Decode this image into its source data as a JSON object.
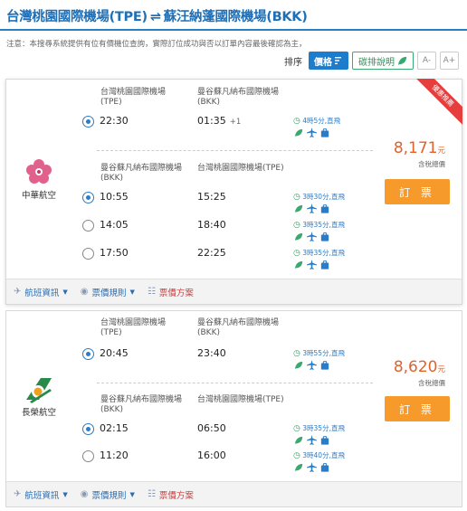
{
  "header": {
    "origin": "台灣桃園國際機場(TPE)",
    "arrow": "⇌",
    "destination": "蘇汪納蓬國際機場(BKK)"
  },
  "notice": "注意：本搜尋系統提供有位有價機位查詢，實際訂位成功與否以訂單內容最後確認為主，",
  "sort": {
    "label": "排序",
    "price_label": "價格",
    "eco_label": "碳排說明",
    "font_small": "A-",
    "font_large": "A+"
  },
  "results": [
    {
      "ribbon": "優惠推薦",
      "airline": "中華航空",
      "price": "8,171",
      "price_unit": "元",
      "tax_note": "含稅總價",
      "book_label": "訂 票",
      "outbound": {
        "dep_airport": "台灣桃園國際機場(TPE)",
        "arr_airport": "曼谷蘇凡納布國際機場(BKK)",
        "options": [
          {
            "dep": "22:30",
            "arr": "01:35",
            "day_offset": "+1",
            "duration": "4時5分,直飛",
            "selected": true
          }
        ]
      },
      "return": {
        "dep_airport": "曼谷蘇凡納布國際機場(BKK)",
        "arr_airport": "台灣桃園國際機場(TPE)",
        "options": [
          {
            "dep": "10:55",
            "arr": "15:25",
            "duration": "3時30分,直飛",
            "selected": true
          },
          {
            "dep": "14:05",
            "arr": "18:40",
            "duration": "3時35分,直飛",
            "selected": false
          },
          {
            "dep": "17:50",
            "arr": "22:25",
            "duration": "3時35分,直飛",
            "selected": false
          }
        ]
      },
      "footer": {
        "flight_info": "航班資訊",
        "fare_rules": "票價規則",
        "fare_plan": "票價方案"
      }
    },
    {
      "airline": "長榮航空",
      "price": "8,620",
      "price_unit": "元",
      "tax_note": "含稅總價",
      "book_label": "訂 票",
      "outbound": {
        "dep_airport": "台灣桃園國際機場(TPE)",
        "arr_airport": "曼谷蘇凡納布國際機場(BKK)",
        "options": [
          {
            "dep": "20:45",
            "arr": "23:40",
            "duration": "3時55分,直飛",
            "selected": true
          }
        ]
      },
      "return": {
        "dep_airport": "曼谷蘇凡納布國際機場(BKK)",
        "arr_airport": "台灣桃園國際機場(TPE)",
        "options": [
          {
            "dep": "02:15",
            "arr": "06:50",
            "duration": "3時35分,直飛",
            "selected": true
          },
          {
            "dep": "11:20",
            "arr": "16:00",
            "duration": "3時40分,直飛",
            "selected": false
          }
        ]
      },
      "footer": {
        "flight_info": "航班資訊",
        "fare_rules": "票價規則",
        "fare_plan": "票價方案"
      }
    }
  ],
  "colors": {
    "accent": "#1e7ccc",
    "price": "#e2622a",
    "book": "#f59a2b",
    "eco": "#3ba86e",
    "ribbon": "#e63d3d"
  }
}
